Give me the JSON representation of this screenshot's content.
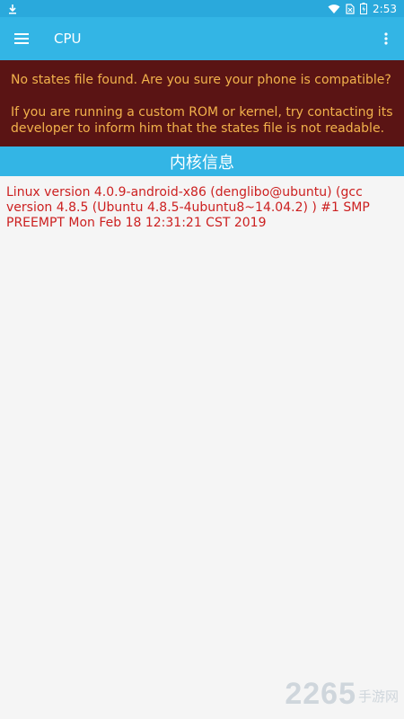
{
  "status_bar": {
    "left_icon": "download-icon",
    "right_icons": [
      "wifi-icon",
      "sim-card-icon",
      "battery-icon"
    ],
    "time": "2:53"
  },
  "app_bar": {
    "menu_icon": "hamburger-menu-icon",
    "title": "CPU",
    "overflow_icon": "more-vert-icon"
  },
  "warning": {
    "line1": "No states file found. Are you sure your phone is compatible?",
    "line2": "If you are running a custom ROM or kernel, try contacting its developer to inform him that the states file is not readable."
  },
  "section": {
    "title": "内核信息"
  },
  "kernel_info": {
    "text": "Linux version 4.0.9-android-x86 (denglibo@ubuntu) (gcc version 4.8.5 (Ubuntu 4.8.5-4ubuntu8~14.04.2) ) #1 SMP PREEMPT Mon Feb 18 12:31:21 CST 2019"
  },
  "watermark": {
    "number": "2265",
    "suffix": "手游网"
  },
  "colors": {
    "status_bar": "#2aa9dc",
    "app_bar": "#33b5e5",
    "warning_bg": "#5a1414",
    "warning_text": "#f2b24c",
    "kernel_text": "#cc1f1f",
    "background": "#f5f5f5"
  }
}
